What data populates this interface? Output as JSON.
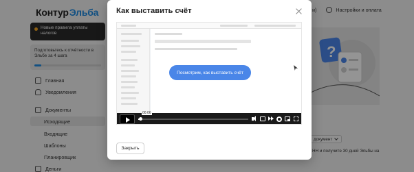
{
  "app": {
    "logo_primary": "Контур",
    "logo_secondary": "Эльба",
    "news_card_text": "Новые правила уплаты налогов",
    "prep_card_text": "Подготовьтесь к отчётности в Эльбе за 4 шага",
    "prep_progress": 0.1,
    "nav": {
      "home": "Главная",
      "notifications": "Уведомления",
      "documents": "Документы",
      "outgoing": "Исходящие",
      "incoming": "Входящие",
      "templates": "Шаблоны",
      "planner": "Планировщик",
      "money": "Деньги"
    },
    "top_right_partial": "и)",
    "settings_label": "Настройки и оплата",
    "send_doc_label": "документ",
    "promo_text_partial": "НН и получите 30 дней Эльбы на"
  },
  "modal": {
    "title": "Как выставить счёт",
    "close_label": "Закрыть",
    "video": {
      "cta_label": "Посмотрим, как выставить счёт",
      "time_label": "00:06",
      "progress": 0.02
    }
  },
  "icons": {
    "close": "close-icon",
    "play": "play-icon",
    "volume": "volume-icon",
    "captions": "captions-icon",
    "speed": "speed-icon",
    "settings": "gear-icon",
    "pip": "pip-icon",
    "fullscreen": "fullscreen-icon"
  },
  "colors": {
    "brand_blue": "#1f8be0",
    "cta_blue": "#4a86e8",
    "dark_card": "#2a2a2a",
    "overlay": "rgba(0,0,0,0.42)"
  }
}
